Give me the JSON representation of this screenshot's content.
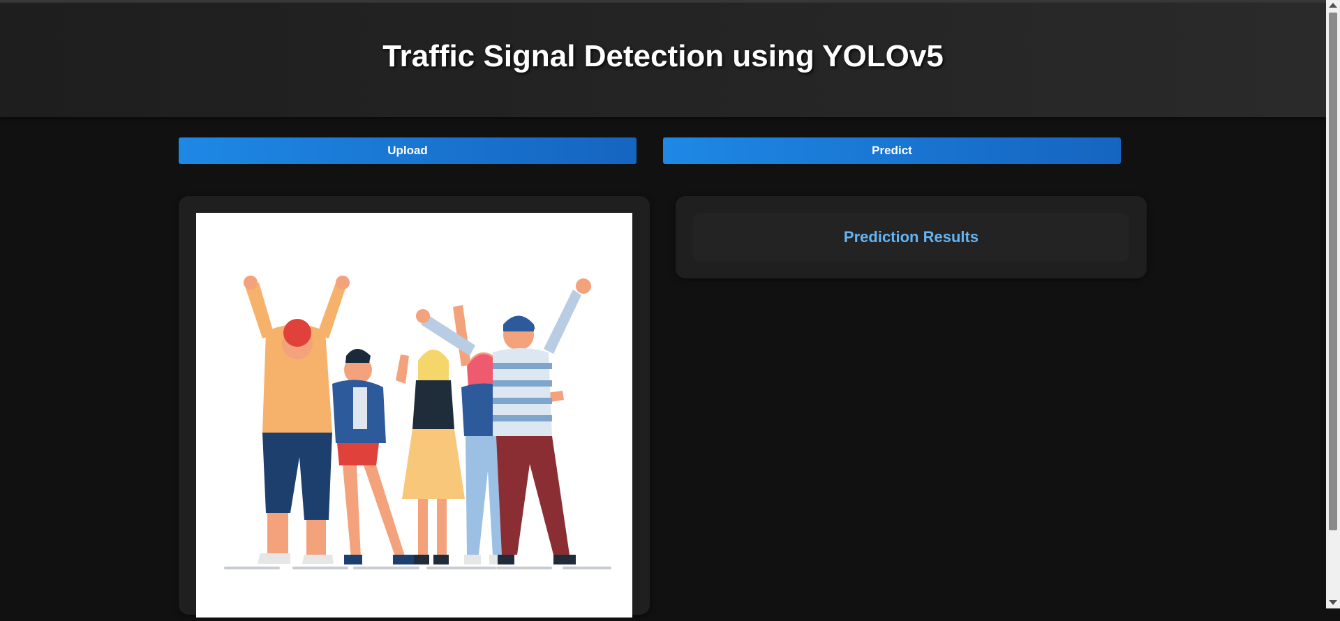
{
  "header": {
    "title": "Traffic Signal Detection using YOLOv5"
  },
  "controls": {
    "upload_label": "Upload",
    "predict_label": "Predict"
  },
  "preview": {
    "image_icon": "people-celebrating-illustration"
  },
  "results": {
    "title": "Prediction Results"
  },
  "colors": {
    "accent": "#1e88e5",
    "result_title": "#64b5f6",
    "background": "#111111"
  }
}
